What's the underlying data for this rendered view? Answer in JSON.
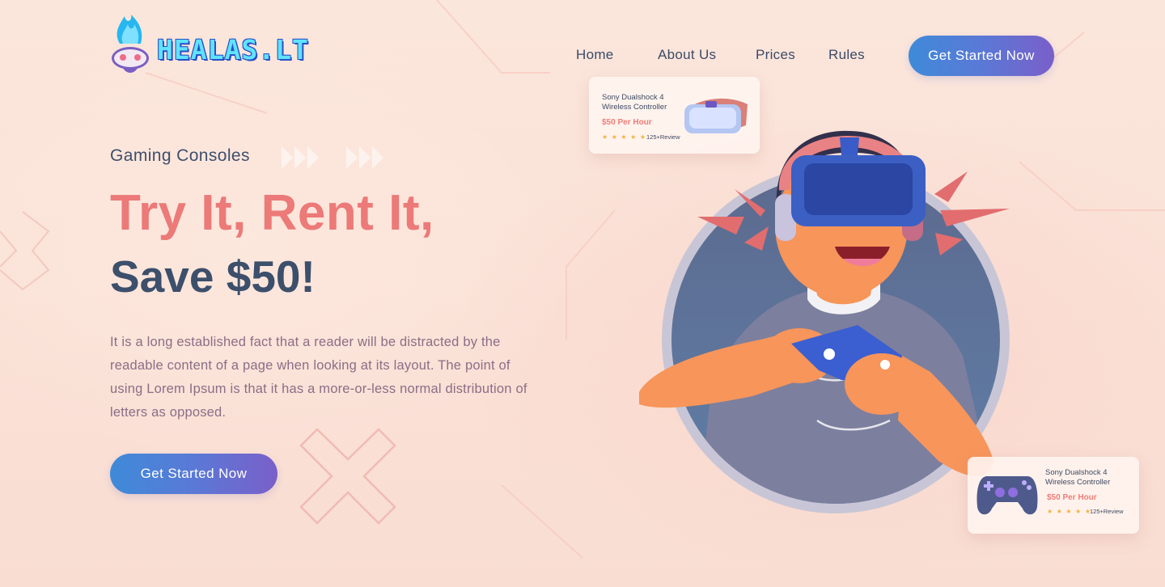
{
  "brand": {
    "logo_text": "HEALAS.LT",
    "colors": {
      "accent_cyan": "#5fe3ff",
      "accent_blue": "#2a4fc6",
      "coral": "#ec7a78",
      "navy": "#3c4f6b"
    }
  },
  "nav": {
    "items": [
      {
        "label": "Home"
      },
      {
        "label": "About Us"
      },
      {
        "label": "Prices"
      },
      {
        "label": "Rules"
      }
    ],
    "cta_label": "Get Started Now"
  },
  "hero": {
    "eyebrow": "Gaming Consoles",
    "headline_line1": "Try It, Rent It,",
    "headline_line2": "Save $50!",
    "description": "It is a long established fact that a reader will be distracted by the readable content of a page when looking at its layout. The point of using Lorem Ipsum is that it has a more-or-less normal distribution of letters as opposed.",
    "cta_label": "Get Started Now"
  },
  "cards": [
    {
      "title": "Sony Dualshock 4 Wireless Controller",
      "price": "$50 Per Hour",
      "stars": "★ ★ ★ ★ ★",
      "reviews": "125+Review",
      "icon": "vr-headset-icon"
    },
    {
      "title": "Sony Dualshock 4 Wireless Controller",
      "price": "$50 Per Hour",
      "stars": "★ ★ ★ ★ ★",
      "reviews": "125+Review",
      "icon": "gamepad-icon"
    }
  ]
}
